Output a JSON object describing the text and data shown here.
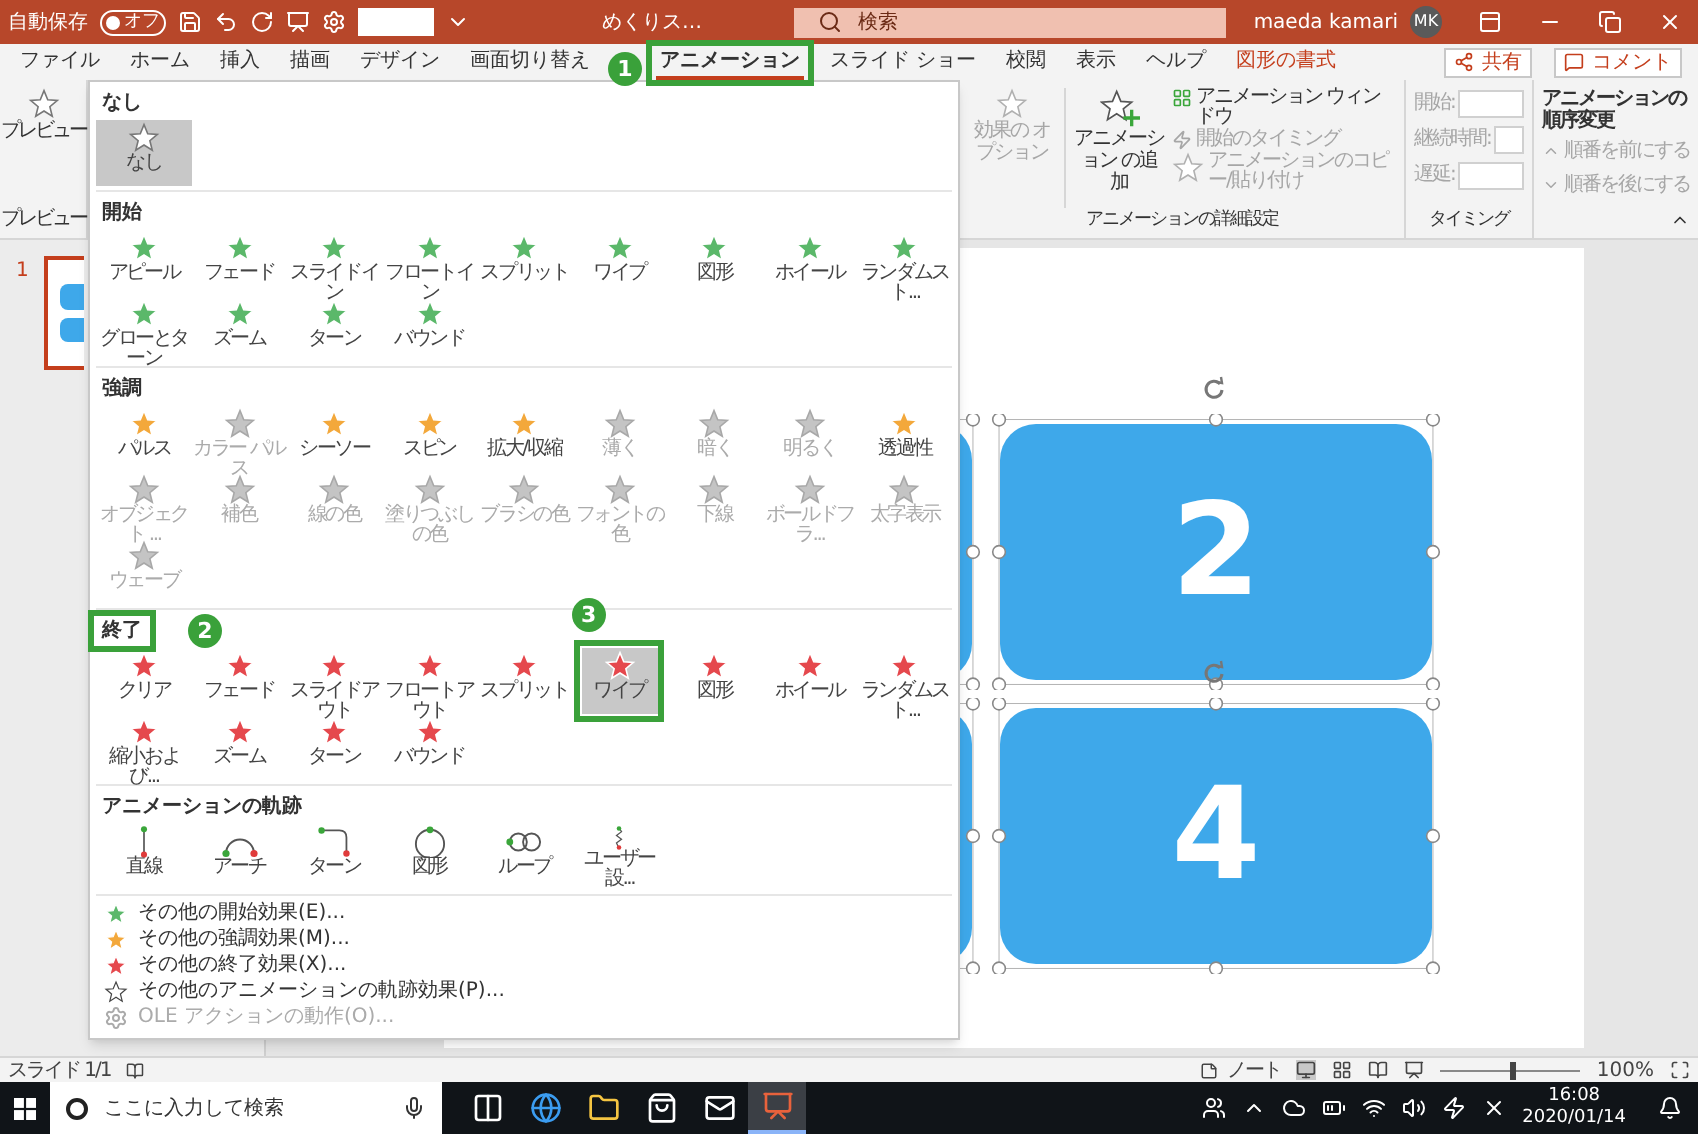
{
  "title_bar": {
    "autosave_label": "自動保存",
    "autosave_toggle": {
      "label": "オフ",
      "on": false
    },
    "file_name": "めくりス…",
    "search": {
      "placeholder": "検索"
    },
    "user_name": "maeda kamari",
    "avatar": "MK"
  },
  "ribbon_tabs": [
    {
      "label": "ファイル",
      "selected": false,
      "kind": "normal"
    },
    {
      "label": "ホーム",
      "selected": false,
      "kind": "normal"
    },
    {
      "label": "挿入",
      "selected": false,
      "kind": "normal"
    },
    {
      "label": "描画",
      "selected": false,
      "kind": "normal"
    },
    {
      "label": "デザイン",
      "selected": false,
      "kind": "normal"
    },
    {
      "label": "画面切り替え",
      "selected": false,
      "kind": "normal"
    },
    {
      "label": "アニメーション",
      "selected": true,
      "kind": "normal",
      "callout": "1"
    },
    {
      "label": "スライド ショー",
      "selected": false,
      "kind": "normal"
    },
    {
      "label": "校閲",
      "selected": false,
      "kind": "normal"
    },
    {
      "label": "表示",
      "selected": false,
      "kind": "normal"
    },
    {
      "label": "ヘルプ",
      "selected": false,
      "kind": "normal"
    },
    {
      "label": "図形の書式",
      "selected": false,
      "kind": "contextual"
    }
  ],
  "share_button": "共有",
  "comment_button": "コメント",
  "ribbon": {
    "preview_button": "プレビュー",
    "preview_group_label": "プレビュー",
    "effect_options": {
      "label": "効果の オプション",
      "disabled": true
    },
    "add_animation": "アニメーション の追加",
    "advanced": [
      {
        "label": "アニメーション ウィンドウ",
        "disabled": false
      },
      {
        "label": "開始のタイミング",
        "disabled": true
      },
      {
        "label": "アニメーションのコピー/貼り付け",
        "disabled": true
      }
    ],
    "advanced_group_label": "アニメーションの詳細設定",
    "timing": [
      {
        "label": "開始:",
        "disabled": true
      },
      {
        "label": "継続時間:",
        "disabled": true
      },
      {
        "label": "遅延:",
        "disabled": true
      }
    ],
    "timing_group_label": "タイミング",
    "reorder_title": "アニメーションの順序変更",
    "reorder": [
      {
        "label": "順番を前にする",
        "disabled": true
      },
      {
        "label": "順番を後にする",
        "disabled": true
      }
    ]
  },
  "gallery": {
    "sections": [
      {
        "title": "なし",
        "kind": "none",
        "items": [
          {
            "label": "なし",
            "selected": true,
            "disabled": false
          }
        ]
      },
      {
        "title": "開始",
        "kind": "entrance",
        "items": [
          {
            "label": "アピール",
            "selected": false,
            "disabled": false
          },
          {
            "label": "フェード",
            "selected": false,
            "disabled": false
          },
          {
            "label": "スライドイン",
            "selected": false,
            "disabled": false
          },
          {
            "label": "フロートイン",
            "selected": false,
            "disabled": false
          },
          {
            "label": "スプリット",
            "selected": false,
            "disabled": false
          },
          {
            "label": "ワイプ",
            "selected": false,
            "disabled": false
          },
          {
            "label": "図形",
            "selected": false,
            "disabled": false
          },
          {
            "label": "ホイール",
            "selected": false,
            "disabled": false
          },
          {
            "label": "ランダムスト...",
            "selected": false,
            "disabled": false
          },
          {
            "label": "グローとターン",
            "selected": false,
            "disabled": false
          },
          {
            "label": "ズーム",
            "selected": false,
            "disabled": false
          },
          {
            "label": "ターン",
            "selected": false,
            "disabled": false
          },
          {
            "label": "バウンド",
            "selected": false,
            "disabled": false
          }
        ]
      },
      {
        "title": "強調",
        "kind": "emphasis",
        "items": [
          {
            "label": "パルス",
            "selected": false,
            "disabled": false
          },
          {
            "label": "カラー パルス",
            "selected": false,
            "disabled": true
          },
          {
            "label": "シーソー",
            "selected": false,
            "disabled": false
          },
          {
            "label": "スピン",
            "selected": false,
            "disabled": false
          },
          {
            "label": "拡大/収縮",
            "selected": false,
            "disabled": false
          },
          {
            "label": "薄く",
            "selected": false,
            "disabled": true
          },
          {
            "label": "暗く",
            "selected": false,
            "disabled": true
          },
          {
            "label": "明るく",
            "selected": false,
            "disabled": true
          },
          {
            "label": "透過性",
            "selected": false,
            "disabled": false
          },
          {
            "label": "オブジェクト ...",
            "selected": false,
            "disabled": true
          },
          {
            "label": "補色",
            "selected": false,
            "disabled": true
          },
          {
            "label": "線の色",
            "selected": false,
            "disabled": true
          },
          {
            "label": "塗りつぶしの色",
            "selected": false,
            "disabled": true
          },
          {
            "label": "ブラシの色",
            "selected": false,
            "disabled": true
          },
          {
            "label": "フォントの色",
            "selected": false,
            "disabled": true
          },
          {
            "label": "下線",
            "selected": false,
            "disabled": true
          },
          {
            "label": "ボールドフラ...",
            "selected": false,
            "disabled": true
          },
          {
            "label": "太字表示",
            "selected": false,
            "disabled": true
          },
          {
            "label": "ウェーブ",
            "selected": false,
            "disabled": true
          }
        ]
      },
      {
        "title": "終了",
        "kind": "exit",
        "callout": "2",
        "items": [
          {
            "label": "クリア",
            "selected": false,
            "disabled": false
          },
          {
            "label": "フェード",
            "selected": false,
            "disabled": false
          },
          {
            "label": "スライドアウト",
            "selected": false,
            "disabled": false
          },
          {
            "label": "フロートアウト",
            "selected": false,
            "disabled": false
          },
          {
            "label": "スプリット",
            "selected": false,
            "disabled": false
          },
          {
            "label": "ワイプ",
            "selected": true,
            "disabled": false,
            "callout": "3"
          },
          {
            "label": "図形",
            "selected": false,
            "disabled": false
          },
          {
            "label": "ホイール",
            "selected": false,
            "disabled": false
          },
          {
            "label": "ランダムスト...",
            "selected": false,
            "disabled": false
          },
          {
            "label": "縮小および...",
            "selected": false,
            "disabled": false
          },
          {
            "label": "ズーム",
            "selected": false,
            "disabled": false
          },
          {
            "label": "ターン",
            "selected": false,
            "disabled": false
          },
          {
            "label": "バウンド",
            "selected": false,
            "disabled": false
          }
        ]
      },
      {
        "title": "アニメーションの軌跡",
        "kind": "path",
        "items": [
          {
            "label": "直線",
            "selected": false,
            "disabled": false,
            "kind": "line"
          },
          {
            "label": "アーチ",
            "selected": false,
            "disabled": false,
            "kind": "arc"
          },
          {
            "label": "ターン",
            "selected": false,
            "disabled": false,
            "kind": "turn"
          },
          {
            "label": "図形",
            "selected": false,
            "disabled": false,
            "kind": "circle"
          },
          {
            "label": "ループ",
            "selected": false,
            "disabled": false,
            "kind": "loop"
          },
          {
            "label": "ユーザー設...",
            "selected": false,
            "disabled": false,
            "kind": "custom"
          }
        ]
      }
    ],
    "more_links": [
      {
        "label": "その他の開始効果(E)...",
        "kind": "entrance",
        "disabled": false
      },
      {
        "label": "その他の強調効果(M)...",
        "kind": "emphasis",
        "disabled": false
      },
      {
        "label": "その他の終了効果(X)...",
        "kind": "exit",
        "disabled": false
      },
      {
        "label": "その他のアニメーションの軌跡効果(P)...",
        "kind": "path",
        "disabled": false
      },
      {
        "label": "OLE アクションの動作(O)...",
        "kind": "ole",
        "disabled": true
      }
    ]
  },
  "slide_pane": {
    "number": "1"
  },
  "slide": {
    "shapes": [
      {
        "label": "2"
      },
      {
        "label": "4"
      }
    ]
  },
  "status_bar": {
    "slide_counter": "スライド 1/1",
    "notes": "ノート",
    "zoom": "100%",
    "zoom_slider": {
      "level": 0.5
    }
  },
  "taskbar": {
    "search": {
      "placeholder": "ここに入力して検索"
    },
    "apps": [
      {
        "kind": "taskview",
        "active": false
      },
      {
        "kind": "browser",
        "active": false
      },
      {
        "kind": "folder",
        "active": false
      },
      {
        "kind": "store",
        "active": false
      },
      {
        "kind": "mail",
        "active": false
      },
      {
        "kind": "slides",
        "active": true
      }
    ],
    "time": "16:08",
    "date": "2020/01/14"
  }
}
